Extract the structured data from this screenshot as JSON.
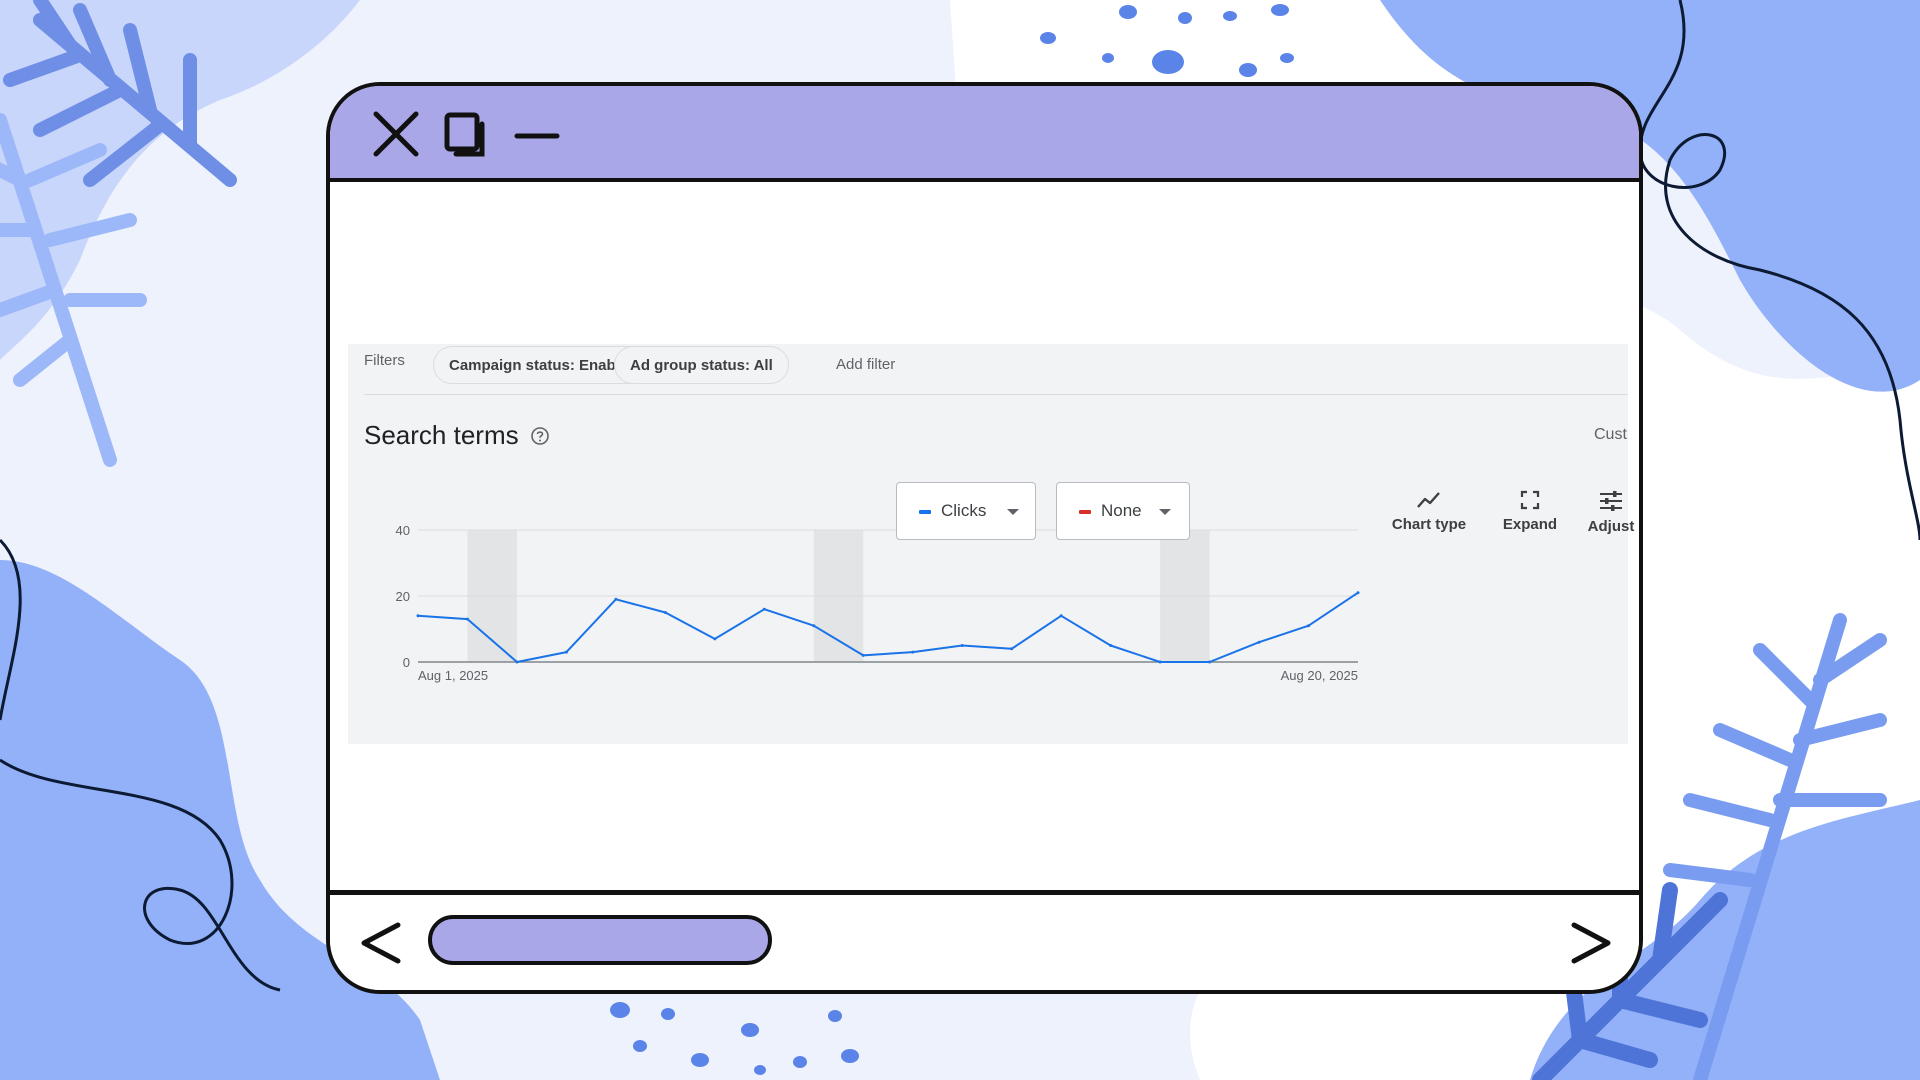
{
  "window_controls": {
    "close": "close",
    "maximize": "maximize",
    "minimize": "minimize"
  },
  "filters": {
    "label": "Filters",
    "chips": [
      "Campaign status: Enabled",
      "Ad group status: All"
    ],
    "add_filter": "Add filter"
  },
  "search_terms": {
    "title": "Search terms",
    "cust_label": "Cust"
  },
  "metrics": [
    {
      "label": "Clicks",
      "color": "#1a73e8"
    },
    {
      "label": "None",
      "color": "#d93025"
    }
  ],
  "tools": [
    {
      "label": "Chart type",
      "icon": "line-chart-icon"
    },
    {
      "label": "Expand",
      "icon": "expand-icon"
    },
    {
      "label": "Adjust",
      "icon": "adjust-icon"
    }
  ],
  "chart_data": {
    "type": "line",
    "x_labels": [
      "Aug 1, 2025",
      "Aug 20, 2025"
    ],
    "x": [
      "2025-08-01",
      "2025-08-02",
      "2025-08-03",
      "2025-08-04",
      "2025-08-05",
      "2025-08-06",
      "2025-08-07",
      "2025-08-08",
      "2025-08-09",
      "2025-08-10",
      "2025-08-11",
      "2025-08-12",
      "2025-08-13",
      "2025-08-14",
      "2025-08-15",
      "2025-08-16",
      "2025-08-17",
      "2025-08-18",
      "2025-08-19",
      "2025-08-20"
    ],
    "series": [
      {
        "name": "Clicks",
        "color": "#1a73e8",
        "values": [
          14,
          13,
          0,
          3,
          19,
          15,
          7,
          16,
          11,
          2,
          3,
          5,
          4,
          14,
          5,
          0,
          0,
          6,
          11,
          21
        ]
      }
    ],
    "yticks": [
      0,
      20,
      40
    ],
    "ylim": [
      0,
      40
    ],
    "weekend_bands": [
      [
        "2025-08-02",
        "2025-08-03"
      ],
      [
        "2025-08-09",
        "2025-08-10"
      ],
      [
        "2025-08-16",
        "2025-08-17"
      ]
    ],
    "grid": true
  },
  "colors": {
    "titlebar": "#aaa7e9",
    "accent": "#1a73e8",
    "background_blue": "#8fb0f7"
  }
}
